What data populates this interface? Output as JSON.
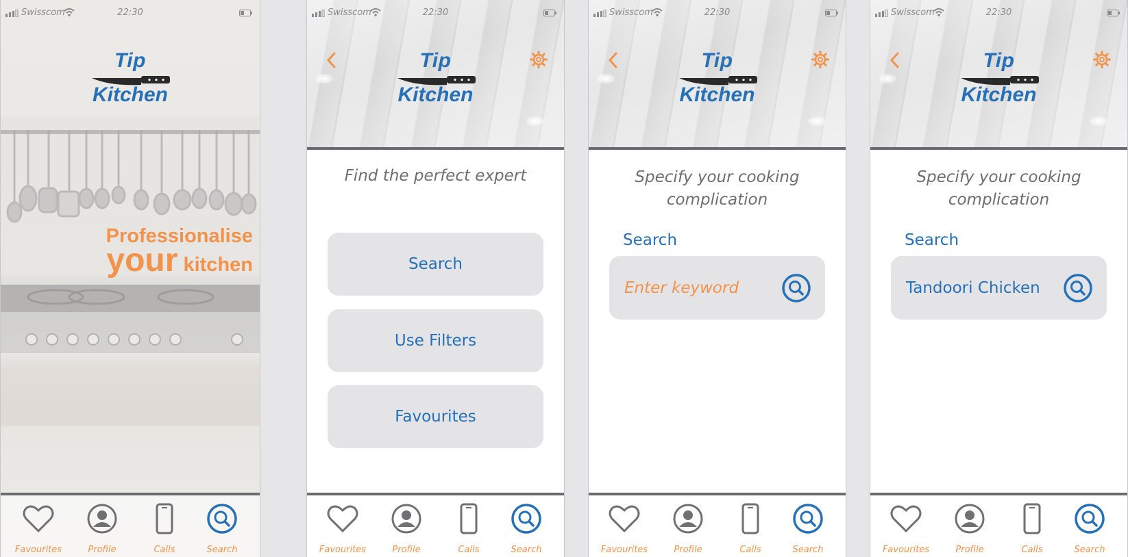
{
  "status_bar": {
    "carrier": "Swisscom",
    "time": "22:30"
  },
  "logo": {
    "line1": "Tip",
    "line2": "Kitchen"
  },
  "splash": {
    "slogan_line1": "Professionalise",
    "slogan_your": "your",
    "slogan_kitchen": "kitchen"
  },
  "home": {
    "prompt": "Find the perfect expert",
    "buttons": [
      "Search",
      "Use Filters",
      "Favourites"
    ]
  },
  "search_screen": {
    "prompt": "Specify your cooking complication",
    "label": "Search",
    "placeholder": "Enter keyword"
  },
  "search_filled": {
    "prompt": "Specify your cooking complication",
    "label": "Search",
    "value": "Tandoori Chicken"
  },
  "tabs": [
    {
      "label": "Favourites",
      "icon": "heart-icon"
    },
    {
      "label": "Profile",
      "icon": "profile-icon"
    },
    {
      "label": "Calls",
      "icon": "phone-icon"
    },
    {
      "label": "Search",
      "icon": "search-icon"
    }
  ],
  "colors": {
    "brand_blue": "#2670b8",
    "accent_orange": "#f2924b",
    "gray_text": "#6e6e70",
    "button_bg": "#e4e4e6"
  }
}
